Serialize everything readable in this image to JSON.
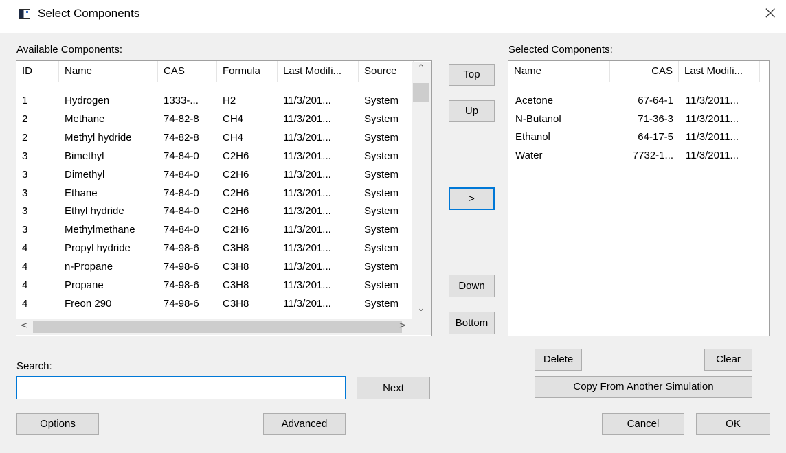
{
  "window": {
    "title": "Select Components",
    "close_icon": "close-icon"
  },
  "available": {
    "label": "Available Components:",
    "columns": [
      "ID",
      "Name",
      "CAS",
      "Formula",
      "Last Modifi...",
      "Source"
    ],
    "rows": [
      [
        "1",
        "Hydrogen",
        "1333-...",
        "H2",
        "11/3/201...",
        "System"
      ],
      [
        "2",
        "Methane",
        "74-82-8",
        "CH4",
        "11/3/201...",
        "System"
      ],
      [
        "2",
        "Methyl hydride",
        "74-82-8",
        "CH4",
        "11/3/201...",
        "System"
      ],
      [
        "3",
        "Bimethyl",
        "74-84-0",
        "C2H6",
        "11/3/201...",
        "System"
      ],
      [
        "3",
        "Dimethyl",
        "74-84-0",
        "C2H6",
        "11/3/201...",
        "System"
      ],
      [
        "3",
        "Ethane",
        "74-84-0",
        "C2H6",
        "11/3/201...",
        "System"
      ],
      [
        "3",
        "Ethyl hydride",
        "74-84-0",
        "C2H6",
        "11/3/201...",
        "System"
      ],
      [
        "3",
        "Methylmethane",
        "74-84-0",
        "C2H6",
        "11/3/201...",
        "System"
      ],
      [
        "4",
        "Propyl hydride",
        "74-98-6",
        "C3H8",
        "11/3/201...",
        "System"
      ],
      [
        "4",
        "n-Propane",
        "74-98-6",
        "C3H8",
        "11/3/201...",
        "System"
      ],
      [
        "4",
        "Propane",
        "74-98-6",
        "C3H8",
        "11/3/201...",
        "System"
      ],
      [
        "4",
        "Freon 290",
        "74-98-6",
        "C3H8",
        "11/3/201...",
        "System"
      ]
    ]
  },
  "selected": {
    "label": "Selected Components:",
    "columns": [
      "Name",
      "CAS",
      "Last Modifi..."
    ],
    "rows": [
      [
        "Acetone",
        "67-64-1",
        "11/3/2011..."
      ],
      [
        "N-Butanol",
        "71-36-3",
        "11/3/2011..."
      ],
      [
        "Ethanol",
        "64-17-5",
        "11/3/2011..."
      ],
      [
        "Water",
        "7732-1...",
        "11/3/2011..."
      ]
    ]
  },
  "move_buttons": {
    "top": "Top",
    "up": "Up",
    "add": ">",
    "down": "Down",
    "bottom": "Bottom"
  },
  "search": {
    "label": "Search:",
    "value": "",
    "next": "Next"
  },
  "buttons": {
    "options": "Options",
    "advanced": "Advanced",
    "delete": "Delete",
    "clear": "Clear",
    "copy": "Copy From Another Simulation",
    "cancel": "Cancel",
    "ok": "OK"
  },
  "colors": {
    "focus_accent": "#0078d7",
    "dialog_bg": "#f0f0f0"
  }
}
